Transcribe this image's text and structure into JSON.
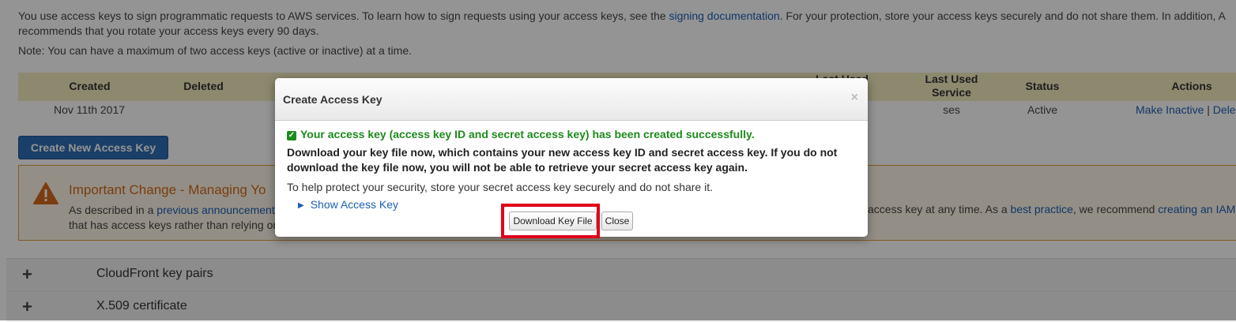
{
  "intro": {
    "text_before": "You use access keys to sign programmatic requests to AWS services. To learn how to sign requests using your access keys, see the",
    "link": "signing documentation",
    "text_after": ". For your protection, store your access keys securely and do not share them. In addition, A",
    "line2": "recommends that you rotate your access keys every 90 days.",
    "note": "Note: You can have a maximum of two access keys (active or inactive) at a time."
  },
  "table": {
    "headers": {
      "created": "Created",
      "deleted": "Deleted",
      "last_used": "Last Used",
      "last_used_service_1": "Last Used",
      "last_used_service_2": "Service",
      "status": "Status",
      "actions": "Actions"
    },
    "row": {
      "created": "Nov 11th 2017",
      "service": "ses",
      "status": "Active",
      "action_inactive": "Make Inactive",
      "action_sep": "|",
      "action_delete": "Dele"
    }
  },
  "create_button": "Create New Access Key",
  "alert": {
    "title": "Important Change - Managing Yo",
    "line1_before": "As described in a",
    "line1_link": "previous announcement",
    "line2": "that has access keys rather than relying on",
    "right_text": "access key at any time. As a",
    "right_link1": "best practice",
    "right_mid": ", we recommend",
    "right_link2": "creating an IAM"
  },
  "sections": [
    "CloudFront key pairs",
    "X.509 certificate"
  ],
  "modal": {
    "title": "Create Access Key",
    "close": "×",
    "success": "Your access key (access key ID and secret access key) has been created successfully.",
    "download_msg": "Download your key file now, which contains your new access key ID and secret access key. If you do not download the key file now, you will not be able to retrieve your secret access key again.",
    "help": "To help protect your security, store your secret access key securely and do not share it.",
    "show_key": "Show Access Key",
    "download_button": "Download Key File",
    "close_button": "Close"
  },
  "colors": {
    "accent": "#2e6db4",
    "highlight": "#e0001b",
    "success": "#1d8a1d",
    "warning": "#d4681a"
  }
}
